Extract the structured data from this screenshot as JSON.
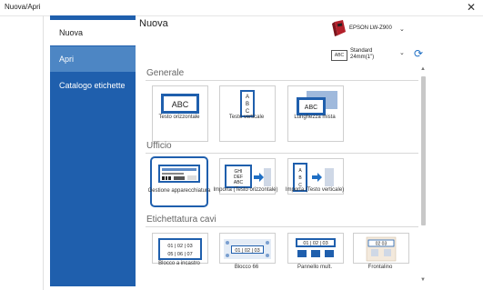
{
  "window": {
    "title": "Nuova/Apri",
    "close_glyph": "✕"
  },
  "sidebar": {
    "items": [
      {
        "label": "Nuova",
        "state": "active"
      },
      {
        "label": "Apri",
        "state": "hover"
      },
      {
        "label": "Catalogo etichette",
        "state": "normal"
      }
    ]
  },
  "main": {
    "heading": "Nuova",
    "printer": {
      "name": "EPSON LW-Z900",
      "icon": "label-printer-icon"
    },
    "tape": {
      "icon_text": "ABC",
      "line1": "Standard",
      "line2": "24mm(1\")"
    },
    "refresh_icon": "refresh-icon",
    "sections": [
      {
        "title": "Generale",
        "tiles": [
          {
            "label": "Testo orizzontale",
            "icon": "horizontal-text-label-icon",
            "icon_text": "ABC"
          },
          {
            "label": "Testo verticale",
            "icon": "vertical-text-label-icon",
            "icon_text": "A B C"
          },
          {
            "label": "Lunghezza mista",
            "icon": "mixed-length-label-icon",
            "icon_text": "ABC"
          }
        ]
      },
      {
        "title": "Ufficio",
        "tiles": [
          {
            "label": "Gestione apparecchiatura",
            "icon": "asset-management-label-icon",
            "selected": true
          },
          {
            "label": "Importa (Testo orizzontale)",
            "icon": "import-horizontal-icon",
            "icon_text": "GHI DEF ABC"
          },
          {
            "label": "Importa (Testo verticale)",
            "icon": "import-vertical-icon",
            "icon_text": "A B C"
          }
        ]
      },
      {
        "title": "Etichettatura cavi",
        "tiles": [
          {
            "label": "Blocco a incastro",
            "icon": "punch-block-icon",
            "icon_text": "01 | 02 | 03  05 | 06 | 07"
          },
          {
            "label": "Blocco 66",
            "icon": "block-66-icon",
            "icon_text": "01 | 02 | 03"
          },
          {
            "label": "Pannello mult.",
            "icon": "patch-panel-icon",
            "icon_text": "01 | 02 | 03"
          },
          {
            "label": "Frontalino",
            "icon": "faceplate-icon",
            "icon_text": "02   03"
          }
        ]
      }
    ]
  }
}
